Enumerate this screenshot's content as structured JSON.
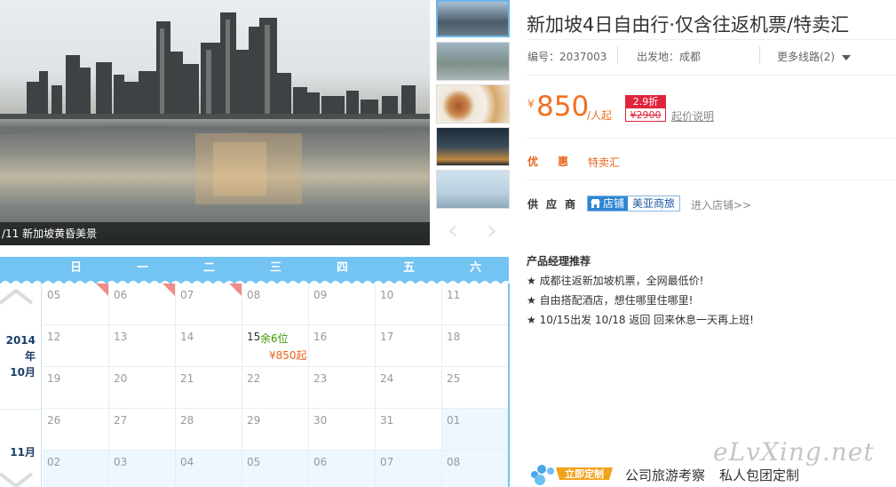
{
  "gallery": {
    "caption": "/11 新加坡黄昏美景",
    "thumbnails": [
      "城市夜景",
      "鱼尾狮",
      "美食",
      "街景夜景",
      "海景"
    ]
  },
  "calendar": {
    "weekdays": [
      "日",
      "一",
      "二",
      "三",
      "四",
      "五",
      "六"
    ],
    "months": [
      {
        "year": "2014年",
        "month": "10月"
      },
      {
        "month": "11月"
      }
    ],
    "rows": [
      [
        "05",
        "06",
        "07",
        "08",
        "09",
        "10",
        "11"
      ],
      [
        "12",
        "13",
        "14",
        "15",
        "16",
        "17",
        "18"
      ],
      [
        "19",
        "20",
        "21",
        "22",
        "23",
        "24",
        "25"
      ],
      [
        "26",
        "27",
        "28",
        "29",
        "30",
        "31",
        "01"
      ],
      [
        "02",
        "03",
        "04",
        "05",
        "06",
        "07",
        "08"
      ]
    ],
    "active_day": {
      "remaining": "余6位",
      "price": "¥850起"
    }
  },
  "product": {
    "title": "新加坡4日自由行·仅含往返机票/特卖汇",
    "code": "编号：2037003",
    "departure": "出发地：成都",
    "more_routes": "更多线路(2)",
    "price_symbol": "¥",
    "price": "850",
    "price_unit": "/人起",
    "discount": "2.9折",
    "original_price": "¥2900",
    "price_note": "起价说明",
    "promo_label": "优惠",
    "promo_value": "特卖汇",
    "supplier_label": "供应商",
    "supplier_shop": "店铺",
    "supplier_name": "美亚商旅",
    "enter_shop": "进入店铺>>"
  },
  "recommend": {
    "title": "产品经理推荐",
    "items": [
      "★ 成都往返新加坡机票，全网最低价!",
      "★ 自由搭配酒店，想住哪里住哪里!",
      "★ 10/15出发 10/18 返回 回来休息一天再上班!"
    ]
  },
  "footer": {
    "badge": "立即定制",
    "link1": "公司旅游考察",
    "link2": "私人包团定制",
    "watermark": "eLvXing.net"
  },
  "colors": {
    "accent_orange": "#f07020",
    "calendar_blue": "#73c3f3",
    "discount_red": "#e0243b"
  }
}
